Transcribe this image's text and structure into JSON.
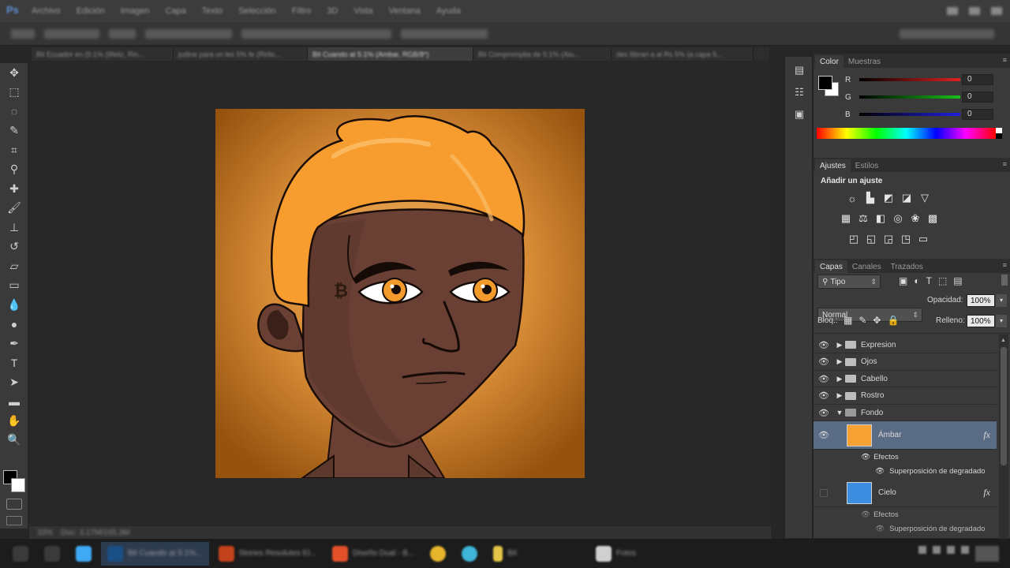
{
  "app": {
    "logo": "Ps",
    "menus": [
      "Archivo",
      "Edición",
      "Imagen",
      "Capa",
      "Texto",
      "Selección",
      "Filtro",
      "3D",
      "Vista",
      "Ventana",
      "Ayuda"
    ]
  },
  "document_tabs": [
    {
      "label": "Bit Ecuador en (5:1% (Ilfeliz, Rin..."
    },
    {
      "label": "judine para un les 5% fe (Rirllo..."
    },
    {
      "label": "Bit Cuando at 5:1% (Ambar, RGB/8*)",
      "active": true
    },
    {
      "label": "Bit Compromptia de 5:1% (Aiu..."
    },
    {
      "label": "des llibrari a al Rs 5% (a capa 5..."
    }
  ],
  "color_panel": {
    "tabs": [
      "Color",
      "Muestras"
    ],
    "channels": [
      {
        "label": "R",
        "value": "0",
        "color": "#e02020"
      },
      {
        "label": "G",
        "value": "0",
        "color": "#18c018"
      },
      {
        "label": "B",
        "value": "0",
        "color": "#2020e0"
      }
    ]
  },
  "adjustments_panel": {
    "tabs": [
      "Ajustes",
      "Estilos"
    ],
    "heading": "Añadir un ajuste",
    "row1": [
      "brightness-icon",
      "levels-icon",
      "curves-icon",
      "exposure-icon",
      "vibrance-icon"
    ],
    "row2": [
      "hue-saturation-icon",
      "color-balance-icon",
      "black-white-icon",
      "photo-filter-icon",
      "channel-mixer-icon",
      "color-lookup-icon"
    ],
    "row3": [
      "invert-icon",
      "posterize-icon",
      "threshold-icon",
      "selective-color-icon",
      "gradient-map-icon"
    ]
  },
  "layers_panel": {
    "tabs": [
      "Capas",
      "Canales",
      "Trazados"
    ],
    "filter_kind": "Tipo",
    "blend_mode": "Normal",
    "opacity_label": "Opacidad:",
    "opacity_value": "100%",
    "lock_label": "Bloq.:",
    "fill_label": "Relleno:",
    "fill_value": "100%",
    "groups": [
      {
        "name": "Expresion"
      },
      {
        "name": "Ojos"
      },
      {
        "name": "Cabello"
      },
      {
        "name": "Rostro"
      },
      {
        "name": "Fondo",
        "expanded": true
      }
    ],
    "layers": [
      {
        "name": "Ámbar",
        "swatch": "#f7a133",
        "selected": true,
        "visible": true,
        "effects_label": "Efectos",
        "effect": "Superposición de degradado"
      },
      {
        "name": "Cielo",
        "swatch": "#3c8fe0",
        "selected": false,
        "visible": false,
        "effects_label": "Efectos",
        "effect": "Superposición de degradado"
      },
      {
        "name": "",
        "swatch": "#6fa858",
        "selected": false,
        "visible": false
      }
    ],
    "fx_label": "fx"
  },
  "taskbar": {
    "items": [
      {
        "label": "",
        "color": "#3fa9f5"
      },
      {
        "label": "",
        "color": "#2a8bd6"
      },
      {
        "label": "Bit Cuando at 5:1%...",
        "color": "#1a4f86",
        "active": true
      },
      {
        "label": "Stories Resolutes El...",
        "color": "#c1421b"
      },
      {
        "label": "Diseño Dual - B...",
        "color": "#e2502a"
      },
      {
        "label": "",
        "color": "#e6b52b"
      },
      {
        "label": "",
        "color": "#3fb5d8"
      },
      {
        "label": "Bit",
        "color": "#e6c648"
      },
      {
        "label": "Fotos",
        "color": "#d0d0d0"
      }
    ]
  },
  "status_bar": {
    "zoom": "33%",
    "doc": "Doc: 3,17M/165,3M"
  }
}
